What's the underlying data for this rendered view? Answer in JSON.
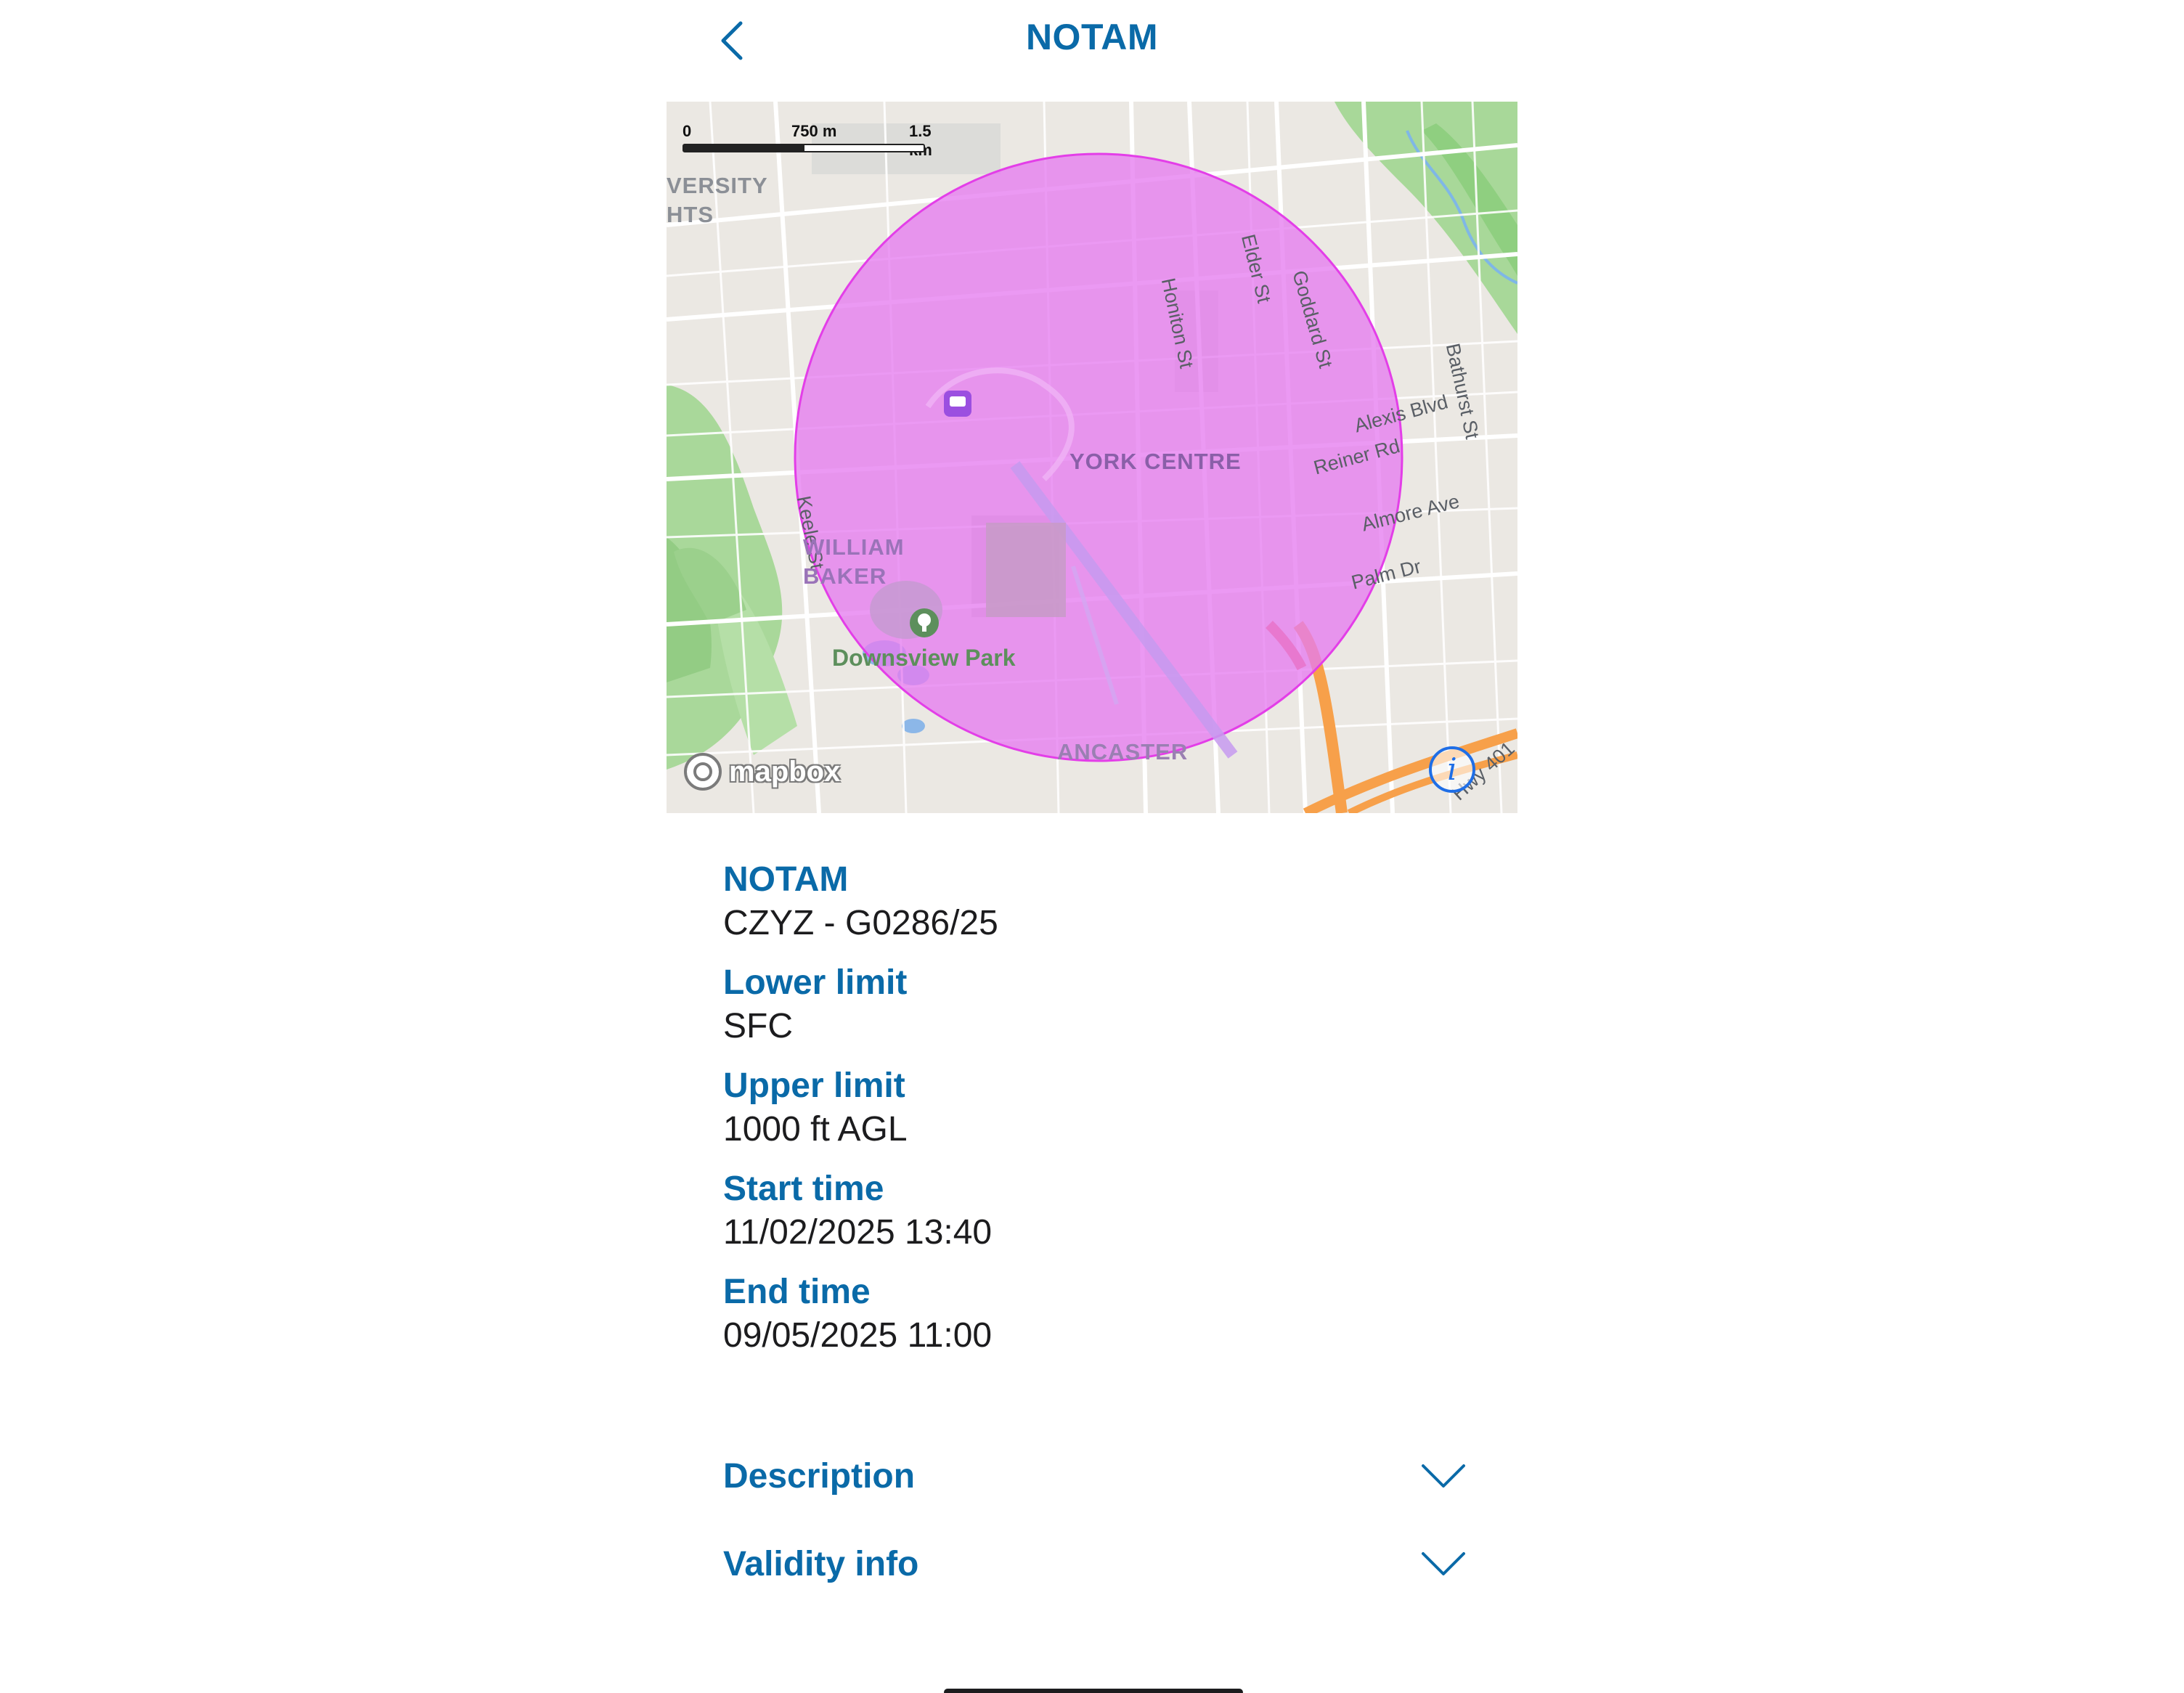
{
  "header": {
    "title": "NOTAM",
    "back_icon": "chevron-left-icon"
  },
  "map": {
    "scale": {
      "zero": "0",
      "mid": "750 m",
      "max": "1.5 km"
    },
    "labels": {
      "university_heights": "VERSITY\nHTS",
      "keele": "Keele St",
      "honiton": "Honiton St",
      "elder": "Elder St",
      "goddard": "Goddard St",
      "bathurst": "Bathurst St",
      "alexis": "Alexis Blvd",
      "reiner": "Reiner Rd",
      "almore": "Almore Ave",
      "palm": "Palm Dr",
      "york_centre": "YORK CENTRE",
      "william_baker": "WILLIAM\nBAKER",
      "downsview": "Downsview Park",
      "ancaster": "ANCASTER",
      "hwy": "Hwy 401"
    },
    "attribution": "mapbox",
    "info_icon": "info-icon",
    "zone_color": "#e67cf0"
  },
  "details": {
    "notam": {
      "label": "NOTAM",
      "value": "CZYZ - G0286/25"
    },
    "lower": {
      "label": "Lower limit",
      "value": "SFC"
    },
    "upper": {
      "label": "Upper limit",
      "value": "1000 ft AGL"
    },
    "start": {
      "label": "Start time",
      "value": "11/02/2025 13:40"
    },
    "end": {
      "label": "End time",
      "value": "09/05/2025 11:00"
    }
  },
  "accordions": {
    "description": {
      "label": "Description",
      "icon": "chevron-down-icon"
    },
    "validity": {
      "label": "Validity info",
      "icon": "chevron-down-icon"
    }
  },
  "colors": {
    "accent": "#0a6aa8",
    "text": "#1c1c1e"
  }
}
